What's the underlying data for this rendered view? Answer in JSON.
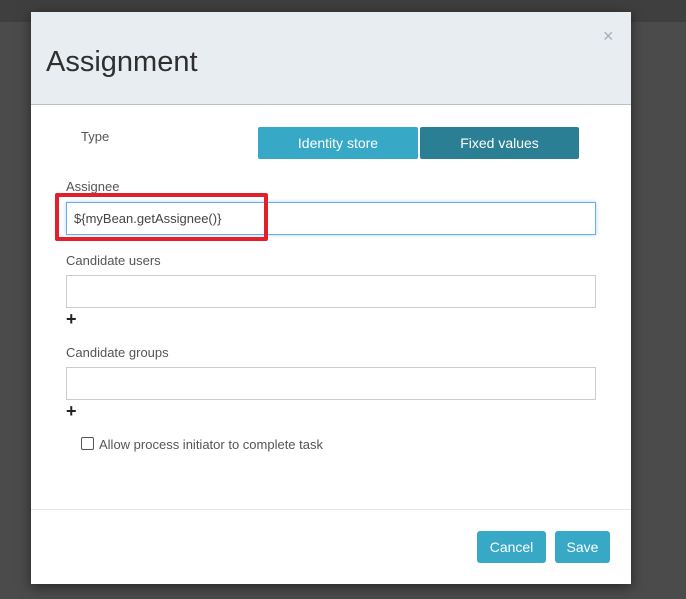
{
  "dialog": {
    "title": "Assignment",
    "close_label": "×"
  },
  "type": {
    "label": "Type",
    "options": [
      "Identity store",
      "Fixed values"
    ],
    "selected": "Fixed values"
  },
  "assignee": {
    "label": "Assignee",
    "value": "${myBean.getAssignee()}"
  },
  "candidate_users": {
    "label": "Candidate users",
    "value": "",
    "add_label": "+"
  },
  "candidate_groups": {
    "label": "Candidate groups",
    "value": "",
    "add_label": "+"
  },
  "allow_initiator": {
    "label": "Allow process initiator to complete task",
    "checked": false
  },
  "footer": {
    "cancel_label": "Cancel",
    "save_label": "Save"
  },
  "colors": {
    "accent": "#37a8c6",
    "selected": "#2a7f95",
    "highlight": "#e2202c"
  }
}
